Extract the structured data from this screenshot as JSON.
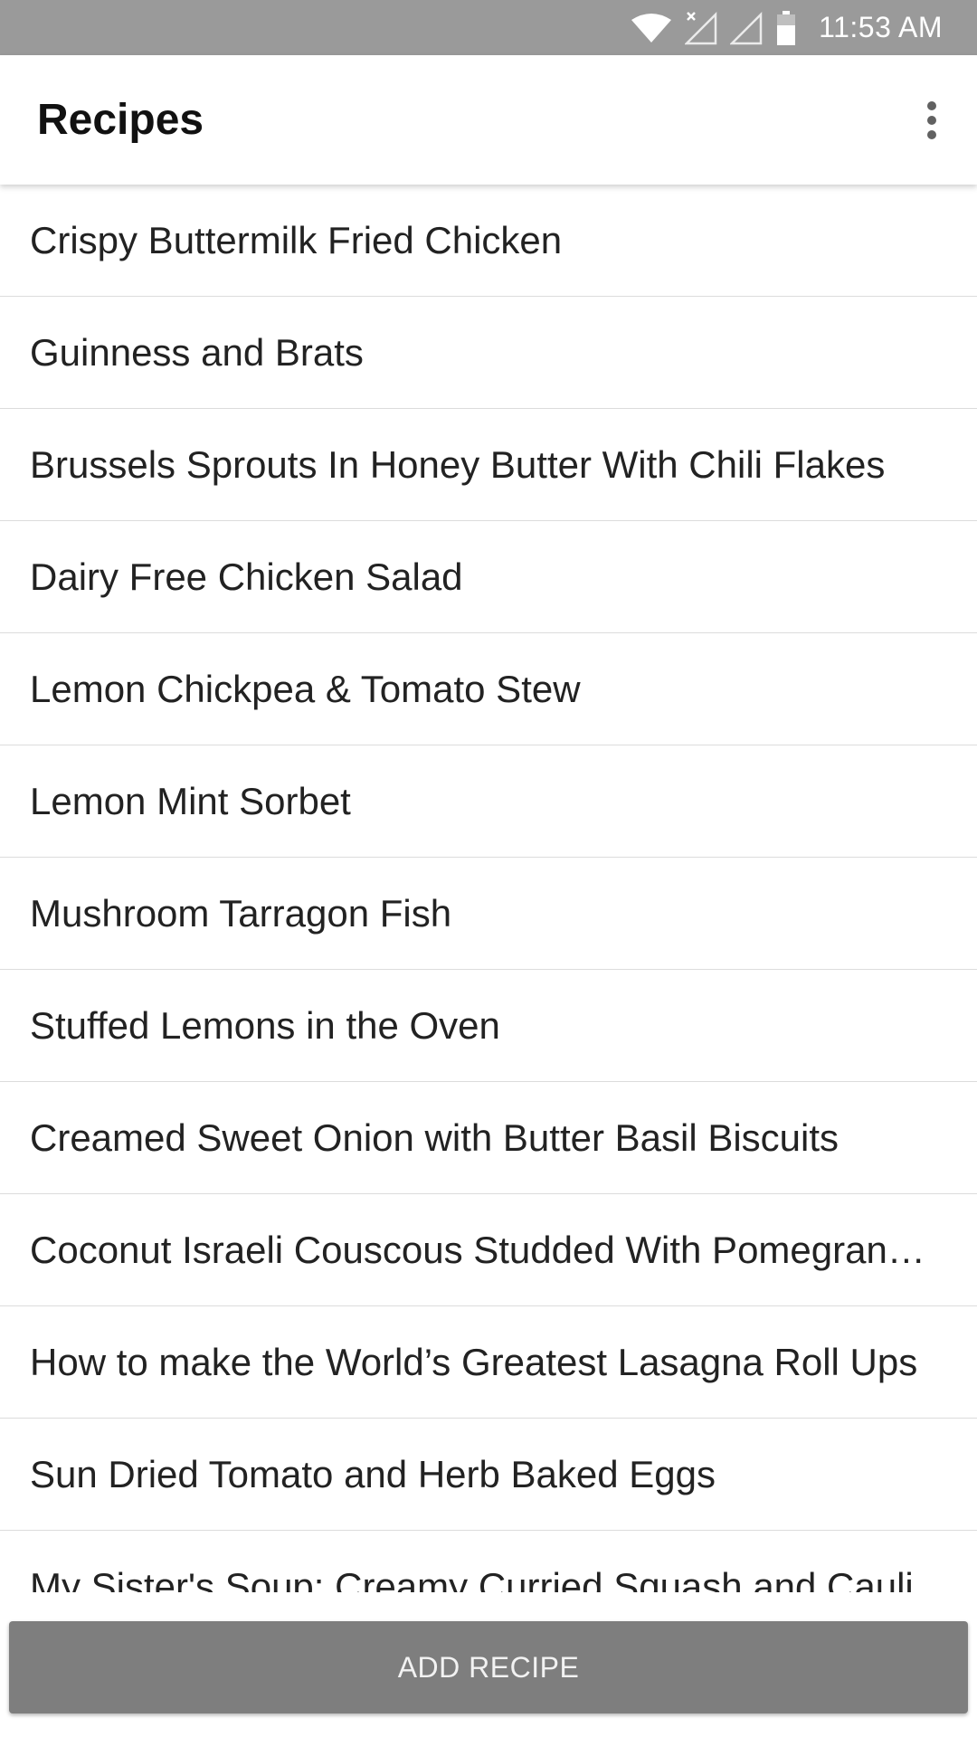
{
  "status_bar": {
    "time": "11:53 AM",
    "icons": [
      "wifi-icon",
      "no-signal-icon",
      "signal-icon",
      "battery-icon"
    ]
  },
  "app_bar": {
    "title": "Recipes",
    "menu_icon": "more-vert-icon"
  },
  "recipes": [
    "Crispy Buttermilk Fried Chicken",
    "Guinness and Brats",
    "Brussels Sprouts In Honey Butter With Chili Flakes",
    "Dairy Free Chicken Salad",
    "Lemon Chickpea & Tomato Stew",
    "Lemon Mint Sorbet",
    "Mushroom Tarragon Fish",
    "Stuffed Lemons in the Oven",
    "Creamed Sweet Onion with Butter Basil Biscuits",
    "Coconut Israeli Couscous Studded With Pomegran…",
    "How to make the World’s Greatest Lasagna Roll Ups",
    "Sun Dried Tomato and Herb Baked Eggs",
    "My Sister's Soup: Creamy Curried Squash and Cauli"
  ],
  "add_button": {
    "label": "ADD RECIPE"
  },
  "colors": {
    "status_bar": "#9a9a9a",
    "button": "#7e7e7e",
    "divider": "#dcdcdc"
  }
}
